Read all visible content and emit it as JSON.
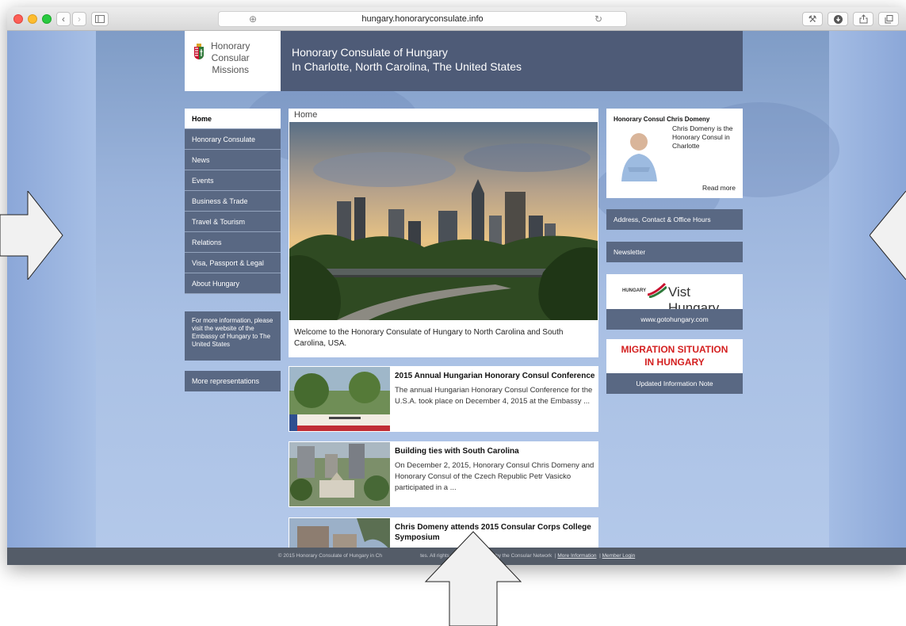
{
  "browser": {
    "url": "hungary.honoraryconsulate.info"
  },
  "logo": {
    "line1": "Honorary",
    "line2": "Consular",
    "line3": "Missions"
  },
  "header": {
    "title_line1": "Honorary Consulate of Hungary",
    "title_line2": "In Charlotte, North Carolina, The United States"
  },
  "nav": {
    "items": [
      {
        "label": "Home"
      },
      {
        "label": "Honorary Consulate"
      },
      {
        "label": "News"
      },
      {
        "label": "Events"
      },
      {
        "label": "Business & Trade"
      },
      {
        "label": "Travel & Tourism"
      },
      {
        "label": "Relations"
      },
      {
        "label": "Visa, Passport & Legal"
      },
      {
        "label": "About Hungary"
      }
    ],
    "info_text": "For more information, please visit the website of the Embassy of Hungary to The United States",
    "more_label": "More representations"
  },
  "main": {
    "title": "Home",
    "welcome": "Welcome to the Honorary Consulate of Hungary to North Carolina and South Carolina, USA.",
    "articles": [
      {
        "title": "2015 Annual Hungarian Honorary Consul Conference",
        "text": "The annual Hungarian Honorary Consul Conference for the U.S.A. took place on December 4, 2015 at the Embassy ..."
      },
      {
        "title": "Building ties with South Carolina",
        "text": "On December 2, 2015, Honorary Consul Chris Domeny and Honorary Consul of the Czech Republic Petr Vasicko participated in a ..."
      },
      {
        "title": "Chris Domeny attends 2015 Consular Corps College Symposium",
        "text": ""
      }
    ]
  },
  "sidebar": {
    "consul_title": "Honorary Consul Chris Domeny",
    "consul_text": "Chris Domeny is the Honorary Consul in Charlotte",
    "read_more": "Read more",
    "address_link": "Address, Contact & Office Hours",
    "newsletter_link": "Newsletter",
    "visit_brand": "HUNGARY",
    "visit_text": "Vist Hungary",
    "visit_link": "www.gotohungary.com",
    "migration_line1": "MIGRATION SITUATION",
    "migration_line2": "IN HUNGARY",
    "migration_link": "Updated Information Note"
  },
  "footer": {
    "copyright_start": "© 2015 Honorary Consulate of Hungary in Ch",
    "copyright_end": "tes. All rights reserved. Powered by the Consular Network",
    "more_info": "More Information",
    "member_login": "Member Login"
  },
  "colors": {
    "header_bg": "#4e5b77",
    "nav_bg": "#596883",
    "migration_red": "#d42020",
    "page_bg": "#9fb8e2"
  }
}
